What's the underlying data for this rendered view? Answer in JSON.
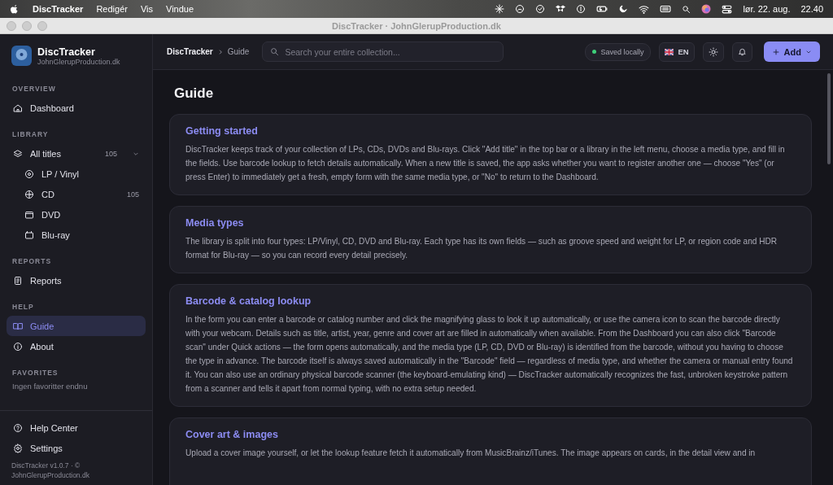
{
  "menubar": {
    "app": "DiscTracker",
    "menus": [
      "Redigér",
      "Vis",
      "Vindue"
    ],
    "date": "lør. 22. aug.",
    "time": "22.40"
  },
  "window": {
    "title": "DiscTracker · JohnGlerupProduction.dk"
  },
  "sidebar": {
    "brand": {
      "name": "DiscTracker",
      "subtitle": "JohnGlerupProduction.dk"
    },
    "sections": [
      {
        "heading": "OVERVIEW",
        "items": [
          {
            "label": "Dashboard",
            "selected": false
          }
        ]
      },
      {
        "heading": "LIBRARY",
        "items": [
          {
            "label": "All titles",
            "count": "105",
            "expanded": true,
            "selected": false,
            "children": [
              {
                "label": "LP / Vinyl",
                "selected": false
              },
              {
                "label": "CD",
                "count": "105",
                "selected": false
              },
              {
                "label": "DVD",
                "selected": false
              },
              {
                "label": "Blu-ray",
                "selected": false
              }
            ]
          }
        ]
      },
      {
        "heading": "REPORTS",
        "items": [
          {
            "label": "Reports",
            "selected": false
          }
        ]
      },
      {
        "heading": "HELP",
        "items": [
          {
            "label": "Guide",
            "selected": true
          },
          {
            "label": "About",
            "selected": false
          }
        ]
      },
      {
        "heading": "FAVORITES",
        "empty_text": "Ingen favoritter endnu"
      }
    ],
    "footer_items": [
      {
        "label": "Help Center"
      },
      {
        "label": "Settings"
      }
    ],
    "version": "DiscTracker v1.0.7 · © JohnGlerupProduction.dk"
  },
  "topbar": {
    "breadcrumb": [
      "DiscTracker",
      "Guide"
    ],
    "search": {
      "placeholder": "Search your entire collection..."
    },
    "status": "Saved locally",
    "language": "EN",
    "add_button": "Add"
  },
  "page": {
    "title": "Guide",
    "cards": [
      {
        "title": "Getting started",
        "body": "DiscTracker keeps track of your collection of LPs, CDs, DVDs and Blu-rays. Click \"Add title\" in the top bar or a library in the left menu, choose a media type, and fill in the fields. Use barcode lookup to fetch details automatically. When a new title is saved, the app asks whether you want to register another one — choose \"Yes\" (or press Enter) to immediately get a fresh, empty form with the same media type, or \"No\" to return to the Dashboard."
      },
      {
        "title": "Media types",
        "body": "The library is split into four types: LP/Vinyl, CD, DVD and Blu-ray. Each type has its own fields — such as groove speed and weight for LP, or region code and HDR format for Blu-ray — so you can record every detail precisely."
      },
      {
        "title": "Barcode & catalog lookup",
        "body": "In the form you can enter a barcode or catalog number and click the magnifying glass to look it up automatically, or use the camera icon to scan the barcode directly with your webcam. Details such as title, artist, year, genre and cover art are filled in automatically when available. From the Dashboard you can also click \"Barcode scan\" under Quick actions — the form opens automatically, and the media type (LP, CD, DVD or Blu-ray) is identified from the barcode, without you having to choose the type in advance. The barcode itself is always saved automatically in the \"Barcode\" field — regardless of media type, and whether the camera or manual entry found it. You can also use an ordinary physical barcode scanner (the keyboard-emulating kind) — DiscTracker automatically recognizes the fast, unbroken keystroke pattern from a scanner and tells it apart from normal typing, with no extra setup needed."
      },
      {
        "title": "Cover art & images",
        "body": "Upload a cover image yourself, or let the lookup feature fetch it automatically from MusicBrainz/iTunes. The image appears on cards, in the detail view and in"
      }
    ]
  }
}
